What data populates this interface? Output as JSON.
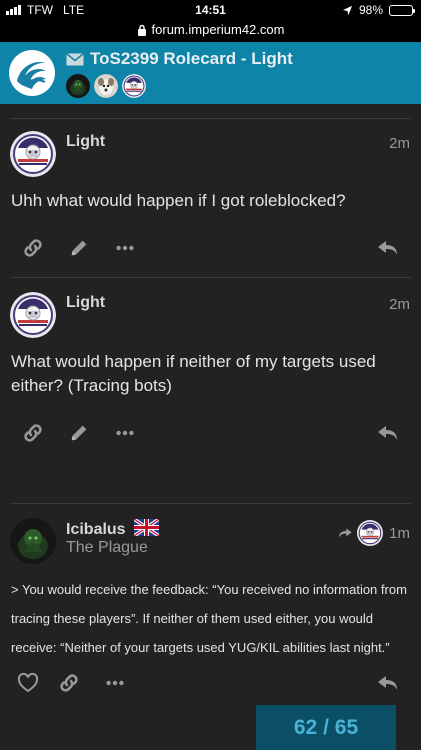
{
  "status_bar": {
    "carrier": "TFW",
    "network": "LTE",
    "time": "14:51",
    "battery": "98%",
    "battery_level": 0.98
  },
  "browser": {
    "url": "forum.imperium42.com"
  },
  "topic": {
    "title": "ToS2399 Rolecard - Light",
    "accent_color": "#0e84a8"
  },
  "posts": [
    {
      "username": "Light",
      "age": "2m",
      "body": "Uhh what would happen if I got roleblocked?"
    },
    {
      "username": "Light",
      "age": "2m",
      "body": "What would happen if neither of my targets used either? (Tracing bots)"
    },
    {
      "username": "Icibalus",
      "user_title": "The Plague",
      "age": "1m",
      "body": "> You would receive the feedback: “You received no information from tracing these players”. If neither of them used either, you would receive: “Neither of your targets used YUG/KIL abilities last night.”"
    }
  ],
  "progress": {
    "current": "62",
    "separator": "/",
    "total": "65"
  }
}
